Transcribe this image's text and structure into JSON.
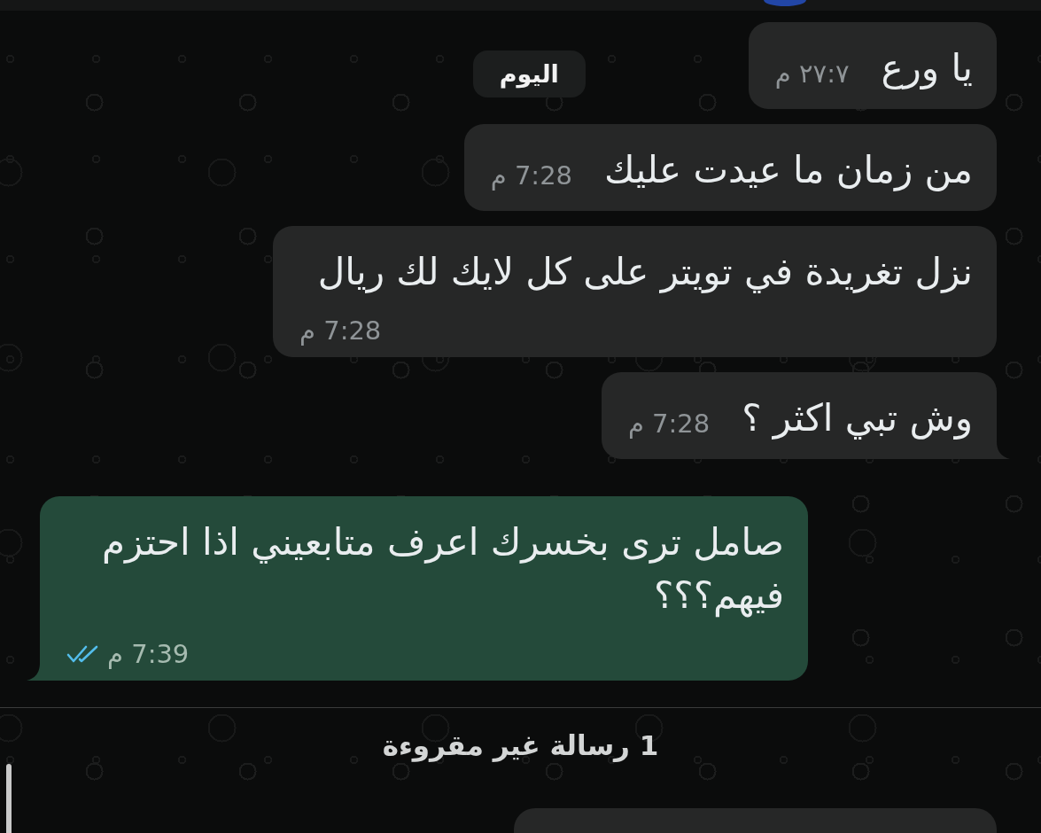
{
  "date_chip": "اليوم",
  "messages": [
    {
      "kind": "received",
      "text": "يا ورع",
      "time": "٢٧:٧ م",
      "tail": false
    },
    {
      "kind": "received",
      "text": "من زمان ما عيدت عليك",
      "time": "7:28 م",
      "tail": false
    },
    {
      "kind": "received",
      "text": "نزل تغريدة في تويتر على كل لايك لك ريال",
      "time": "7:28 م",
      "tail": false
    },
    {
      "kind": "received",
      "text": "وش تبي اكثر ؟",
      "time": "7:28 م",
      "tail": true
    },
    {
      "kind": "sent",
      "text": "صامل ترى بخسرك اعرف متابعيني اذا احتزم فيهم؟؟؟",
      "time": "7:39 م",
      "tail": true,
      "read": true
    }
  ],
  "unread_banner": "1 رسالة غير مقروءة",
  "next_message": {
    "kind": "received"
  }
}
